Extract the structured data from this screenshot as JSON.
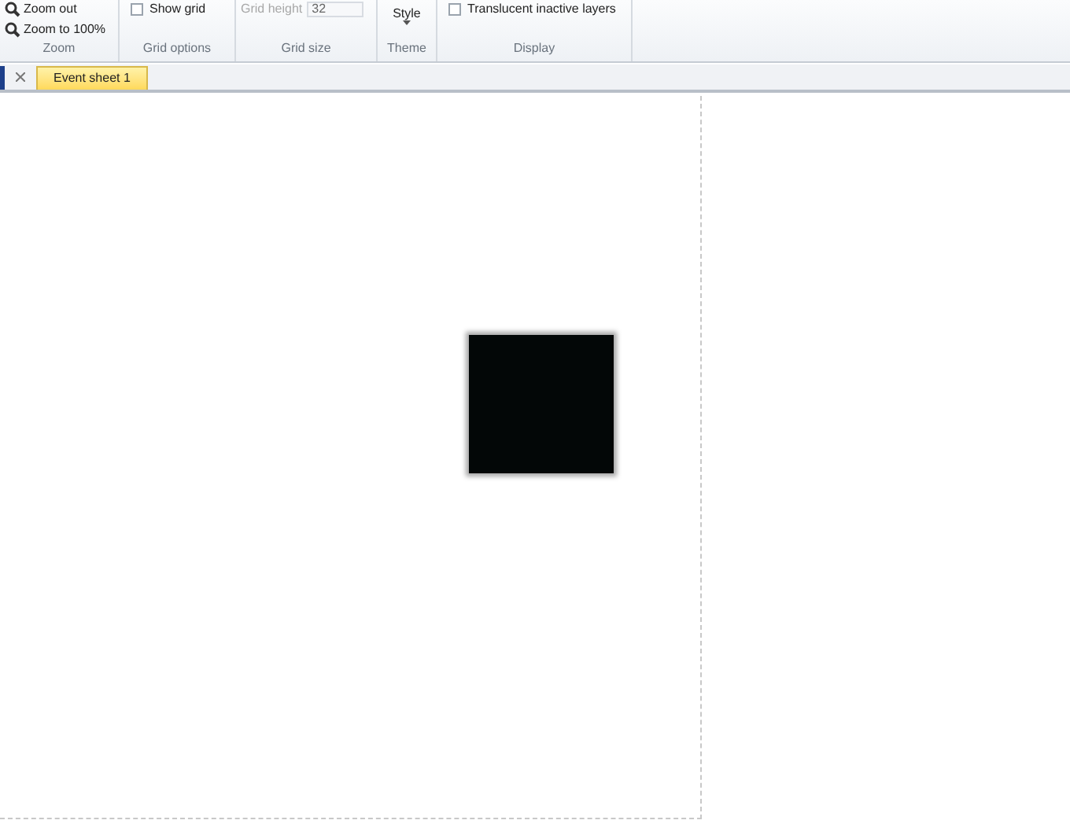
{
  "ribbon": {
    "groups": [
      {
        "label": "Zoom",
        "items": [
          {
            "kind": "button",
            "label": "Zoom out"
          },
          {
            "kind": "button",
            "label": "Zoom to 100%"
          }
        ]
      },
      {
        "label": "Grid options",
        "items": [
          {
            "kind": "checkbox",
            "label": "Show grid",
            "checked": false
          }
        ]
      },
      {
        "label": "Grid size",
        "items": [
          {
            "kind": "field",
            "label": "Grid height",
            "value": "32",
            "disabled": true
          }
        ]
      },
      {
        "label": "Theme",
        "items": [
          {
            "kind": "dropdown",
            "label": "Style"
          }
        ]
      },
      {
        "label": "Display",
        "items": [
          {
            "kind": "checkbox",
            "label": "Translucent inactive layers",
            "checked": false
          }
        ]
      }
    ]
  },
  "tabs": [
    {
      "label": "Event sheet 1",
      "selected": true
    }
  ]
}
